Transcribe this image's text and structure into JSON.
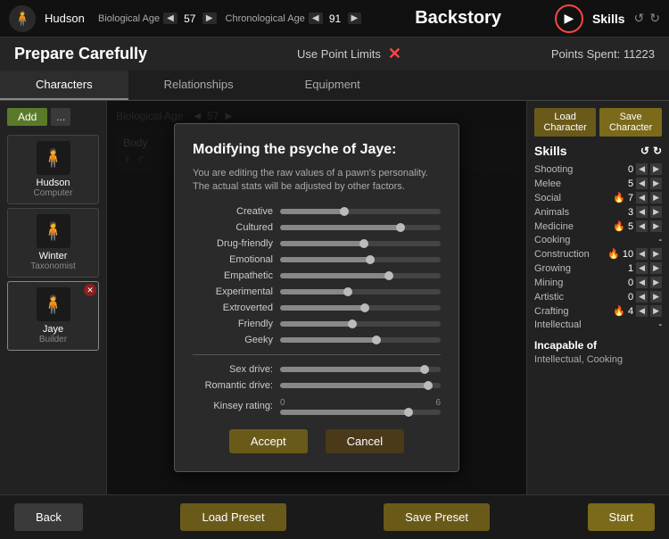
{
  "topbar": {
    "character_name": "Hudson",
    "bio_age_label": "Biological Age",
    "bio_age_value": "57",
    "chron_age_label": "Chronological Age",
    "chron_age_value": "91",
    "title": "Backstory",
    "skills_label": "Skills",
    "play_icon": "▶"
  },
  "header": {
    "page_title": "Prepare Carefully",
    "use_point_limits": "Use Point Limits",
    "points_spent": "Points Spent: 11223"
  },
  "tabs": [
    {
      "label": "Characters",
      "active": true
    },
    {
      "label": "Relationships",
      "active": false
    },
    {
      "label": "Equipment",
      "active": false
    }
  ],
  "characters": [
    {
      "name": "Hudson",
      "role": "Computer",
      "avatar": "🧍"
    },
    {
      "name": "Winter",
      "role": "Taxonomist",
      "avatar": "🧍"
    },
    {
      "name": "Jaye",
      "role": "Builder",
      "avatar": "🧍",
      "selected": true
    }
  ],
  "sidebar_add": "Add",
  "sidebar_more": "...",
  "bio_age_label": "Biological Age",
  "bio_age_value": "57",
  "body_section_label": "Body",
  "right_panel": {
    "load_char": "Load Character",
    "save_char": "Save Character",
    "skills_title": "Skills",
    "skills": [
      {
        "name": "Shooting",
        "value": "0"
      },
      {
        "name": "Melee",
        "value": "5"
      },
      {
        "name": "Social",
        "value": "7",
        "fire": true
      },
      {
        "name": "Animals",
        "value": "3"
      },
      {
        "name": "Medicine",
        "value": "5",
        "fire": true
      },
      {
        "name": "Cooking",
        "value": "-"
      },
      {
        "name": "Construction",
        "value": "10",
        "fire": true
      },
      {
        "name": "Growing",
        "value": "1"
      },
      {
        "name": "Mining",
        "value": "0"
      },
      {
        "name": "Artistic",
        "value": "0"
      },
      {
        "name": "Crafting",
        "value": "4",
        "fire": true
      },
      {
        "name": "Intellectual",
        "value": "-"
      }
    ],
    "incapable_label": "Incapable of",
    "incapable_text": "Intellectual, Cooking"
  },
  "modal": {
    "title": "Modifying the psyche of Jaye:",
    "description": "You are editing the raw values of a pawn's personality. The actual stats will be adjusted by other factors.",
    "traits": [
      {
        "label": "Creative",
        "value": 40
      },
      {
        "label": "Cultured",
        "value": 75
      },
      {
        "label": "Drug-friendly",
        "value": 52
      },
      {
        "label": "Emotional",
        "value": 56
      },
      {
        "label": "Empathetic",
        "value": 68
      },
      {
        "label": "Experimental",
        "value": 42
      },
      {
        "label": "Extroverted",
        "value": 53
      },
      {
        "label": "Friendly",
        "value": 45
      },
      {
        "label": "Geeky",
        "value": 60
      }
    ],
    "sex_drive_label": "Sex drive:",
    "sex_drive_value": 90,
    "romantic_drive_label": "Romantic drive:",
    "romantic_drive_value": 92,
    "kinsey_label": "Kinsey rating:",
    "kinsey_min": "0",
    "kinsey_max": "6",
    "kinsey_value": 5,
    "accept_label": "Accept",
    "cancel_label": "Cancel"
  },
  "bottom": {
    "back_label": "Back",
    "load_preset_label": "Load Preset",
    "save_preset_label": "Save Preset",
    "start_label": "Start"
  }
}
